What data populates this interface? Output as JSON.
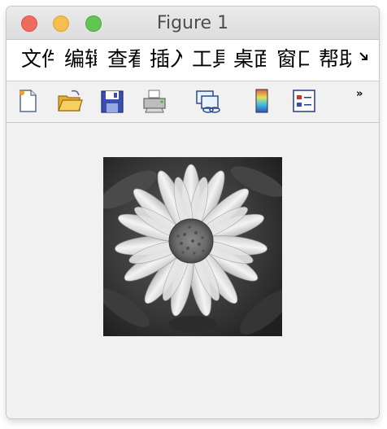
{
  "window": {
    "title": "Figure 1"
  },
  "menu": {
    "items": [
      {
        "label": "文件"
      },
      {
        "label": "编辑"
      },
      {
        "label": "查看"
      },
      {
        "label": "插入"
      },
      {
        "label": "工具"
      },
      {
        "label": "桌面"
      },
      {
        "label": "窗口"
      },
      {
        "label": "帮助"
      }
    ],
    "overflow_icon": "menu-overflow-arrow"
  },
  "toolbar": {
    "buttons": [
      {
        "icon": "new-figure-icon"
      },
      {
        "icon": "open-file-icon"
      },
      {
        "icon": "save-icon"
      },
      {
        "icon": "print-icon"
      },
      {
        "icon": "link-plot-icon"
      },
      {
        "icon": "colorbar-icon"
      },
      {
        "icon": "legend-icon"
      }
    ],
    "overflow_label": "»"
  },
  "figure": {
    "image": "grayscale daisy flower photo"
  }
}
